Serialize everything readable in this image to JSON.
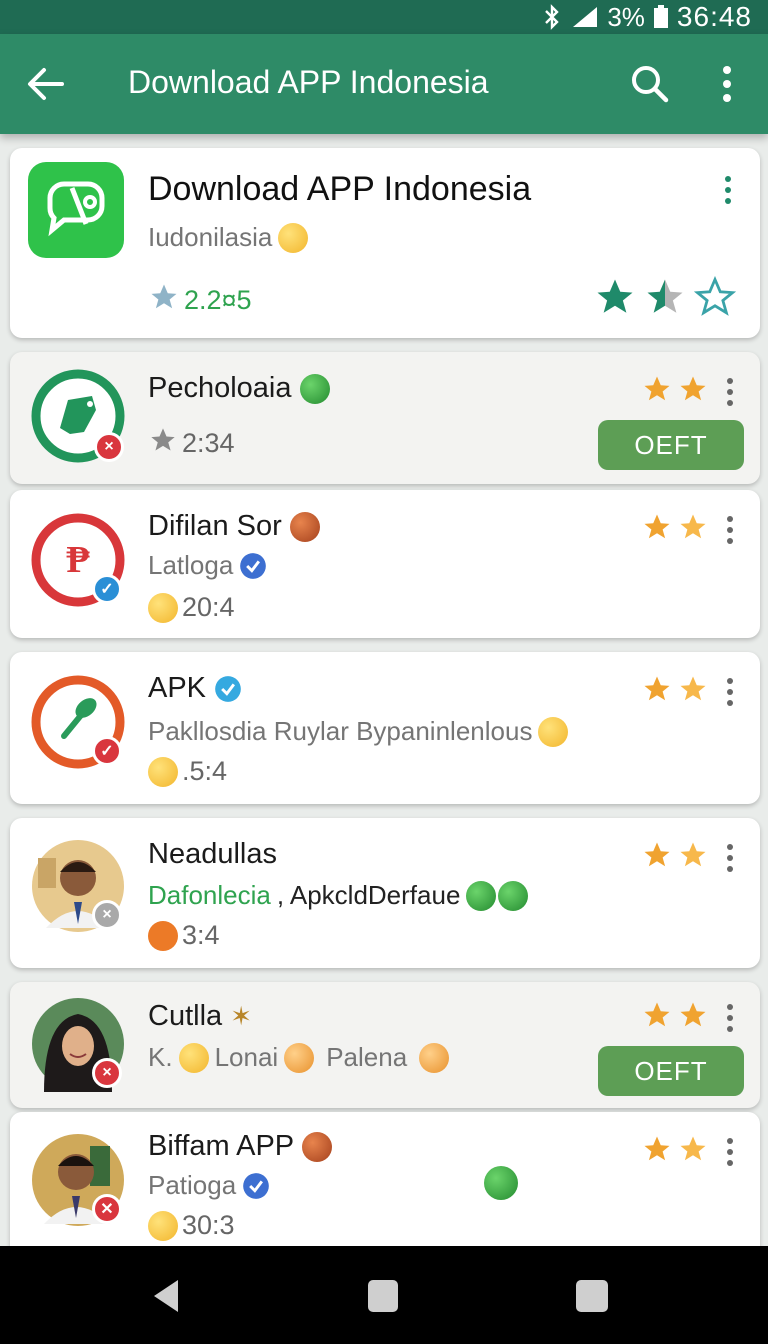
{
  "status": {
    "battery_pct": "3%",
    "time": "36:48"
  },
  "appbar": {
    "title": "Download APP Indonesia"
  },
  "featured": {
    "title": "Download APP Indonesia",
    "subtitle": "Iudonilasia",
    "rating": "2.2¤5",
    "star_fill": [
      1,
      0.5,
      0
    ],
    "icon_color": "#2fc24a"
  },
  "apps": [
    {
      "name": "Pecholoaia",
      "rating": "2:34",
      "button": "OEFT",
      "stars": 2
    },
    {
      "name": "Difilan Sor",
      "subtitle": "Latloga",
      "rating": "20:4",
      "stars": 2
    },
    {
      "name": "APK",
      "subtitle": "Pakllosdia Ruylar Bypaninlenlous",
      "rating": ".5:4",
      "stars": 2
    },
    {
      "name": "Neadullas",
      "subtitle_green": "Dafonlecia",
      "subtitle_dark": ", ApkcldDerfaue",
      "rating": "3:4",
      "stars": 2
    },
    {
      "name": "Cutlla",
      "subtitle_parts": [
        "K.",
        "Lonai",
        "Palena"
      ],
      "button": "OEFT",
      "stars": 2
    },
    {
      "name": "Biffam APP",
      "subtitle": "Patioga",
      "rating": "30:3",
      "stars": 2
    }
  ],
  "colors": {
    "accent": "#2e8b67",
    "status": "#1f6b53",
    "button": "#5d9e55",
    "star": "#f0a330",
    "teal_star": "#1f8a6a"
  }
}
